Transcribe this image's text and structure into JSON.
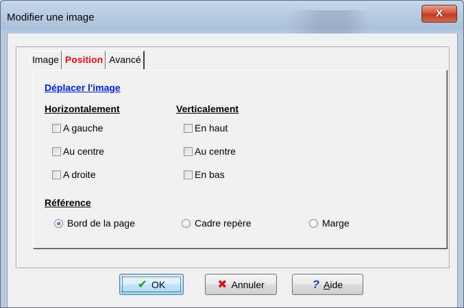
{
  "window": {
    "title": "Modifier une image",
    "close_label": "X"
  },
  "tabs": [
    {
      "label": "Image",
      "active": false
    },
    {
      "label": "Position",
      "active": true
    },
    {
      "label": "Avancé",
      "active": false
    }
  ],
  "move_section": {
    "title": "Déplacer l'image",
    "horizontal": {
      "title": "Horizontalement",
      "options": [
        {
          "label": "A gauche",
          "checked": false
        },
        {
          "label": "Au centre",
          "checked": false
        },
        {
          "label": "A droite",
          "checked": false
        }
      ]
    },
    "vertical": {
      "title": "Verticalement",
      "options": [
        {
          "label": "En haut",
          "checked": false
        },
        {
          "label": "Au centre",
          "checked": false
        },
        {
          "label": "En bas",
          "checked": false
        }
      ]
    }
  },
  "reference": {
    "title": "Référence",
    "options": [
      {
        "label": "Bord de la page",
        "selected": true
      },
      {
        "label": "Cadre repère",
        "selected": false
      },
      {
        "label": "Marge",
        "selected": false
      }
    ]
  },
  "buttons": {
    "ok": "OK",
    "cancel": "Annuler",
    "help": "Aide"
  },
  "colors": {
    "active_tab": "#e0101a",
    "link_heading": "#0020d0",
    "close_button": "#c13b21"
  },
  "icons": {
    "ok": "checkmark-icon",
    "cancel": "cross-icon",
    "help": "question-icon"
  }
}
